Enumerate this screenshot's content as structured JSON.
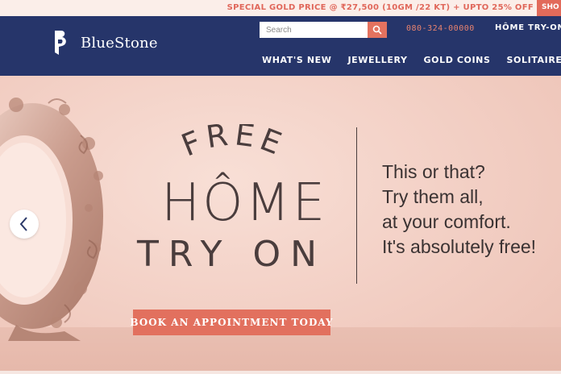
{
  "promo": {
    "text": "SPECIAL GOLD PRICE @ ₹27,500 (10GM /22 KT) + UPTO 25% OFF",
    "shop_label": "SHO"
  },
  "header": {
    "brand": "BlueStone",
    "search": {
      "placeholder": "Search",
      "value": ""
    },
    "phone": "080-324-00000",
    "home_try_on": "HÔME TRY-ON",
    "nav": [
      "WHAT'S NEW",
      "JEWELLERY",
      "GOLD COINS",
      "SOLITAIRES"
    ]
  },
  "hero": {
    "logo_word_1": "FREE",
    "logo_word_2": "HÔME",
    "logo_word_3": "TRY ON",
    "tagline": [
      "This or that?",
      "Try them all,",
      "at your comfort.",
      "It's absolutely free!"
    ],
    "cta": "BOOK AN APPOINTMENT TODAY"
  },
  "colors": {
    "header_bg": "#26356a",
    "accent": "#e2705e",
    "hero_bg": "#f2cec3",
    "promo_text": "#e0675a"
  },
  "icons": {
    "search": "search-icon",
    "prev": "chevron-left-icon",
    "logo": "bluestone-logo-icon"
  }
}
